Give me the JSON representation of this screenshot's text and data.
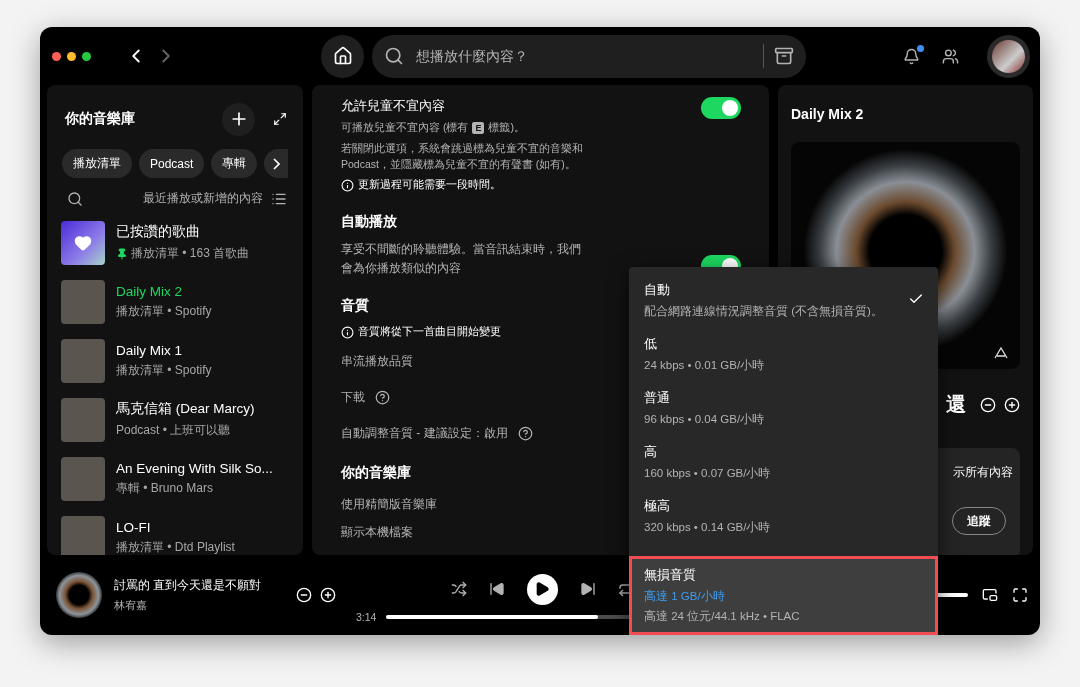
{
  "topbar": {
    "search": {
      "placeholder": "想播放什麼內容？"
    },
    "notification_dot": true
  },
  "library": {
    "title": "你的音樂庫",
    "filters": [
      {
        "label": "播放清單",
        "selected": false
      },
      {
        "label": "Podcast",
        "selected": false
      },
      {
        "label": "專輯",
        "selected": false
      }
    ],
    "sort_label": "最近播放或新增的內容",
    "items": [
      {
        "kind": "liked",
        "title": "已按讚的歌曲",
        "subtitle": "播放清單 • 163 首歌曲",
        "pinned": true,
        "playing": false
      },
      {
        "kind": "photo",
        "title": "Daily Mix 2",
        "subtitle": "播放清單 • Spotify",
        "pinned": false,
        "playing": true
      },
      {
        "kind": "photo",
        "title": "Daily Mix 1",
        "subtitle": "播放清單 • Spotify",
        "pinned": false,
        "playing": false
      },
      {
        "kind": "photo",
        "title": "馬克信箱 (Dear Marcy)",
        "subtitle": "Podcast • 上班可以聽",
        "pinned": false,
        "playing": false
      },
      {
        "kind": "photo",
        "title": "An Evening With Silk So...",
        "subtitle": "專輯 • Bruno Mars",
        "pinned": false,
        "playing": false
      },
      {
        "kind": "photo",
        "title": "LO-FI",
        "subtitle": "播放清單 • Dtd Playlist",
        "pinned": false,
        "playing": false
      }
    ]
  },
  "settings": {
    "explicit": {
      "title": "允許兒童不宜內容",
      "on": true,
      "note_before": "可播放兒童不宜內容 (標有",
      "badge": "E",
      "note_after": "標籤)。",
      "description": "若關閉此選項，系統會跳過標為兒童不宜的音樂和 Podcast，並隱藏標為兒童不宜的有聲書 (如有)。",
      "info": "更新過程可能需要一段時間。"
    },
    "autoplay": {
      "heading": "自動播放",
      "description": "享受不間斷的聆聽體驗。當音訊結束時，我們會為你播放類似的內容",
      "on": true
    },
    "quality": {
      "heading": "音質",
      "info": "音質將從下一首曲目開始變更",
      "rows": [
        {
          "label": "串流播放品質",
          "help": false
        },
        {
          "label": "下載",
          "help": true
        },
        {
          "label": "自動調整音質 - 建議設定：啟用",
          "help": true
        }
      ]
    },
    "library": {
      "heading": "你的音樂庫",
      "rows": [
        "使用精簡版音樂庫",
        "顯示本機檔案"
      ]
    }
  },
  "quality_menu": [
    {
      "title": "自動",
      "detail": "配合網路連線情況調整音質 (不含無損音質)。",
      "selected": true,
      "highlighted": false
    },
    {
      "title": "低",
      "detail": "24 kbps • 0.01 GB/小時",
      "selected": false,
      "highlighted": false
    },
    {
      "title": "普通",
      "detail": "96 kbps • 0.04 GB/小時",
      "selected": false,
      "highlighted": false
    },
    {
      "title": "高",
      "detail": "160 kbps • 0.07 GB/小時",
      "selected": false,
      "highlighted": false
    },
    {
      "title": "極高",
      "detail": "320 kbps • 0.14 GB/小時",
      "selected": false,
      "highlighted": false
    },
    {
      "title": "無損音質",
      "accent": "高達 1 GB/小時",
      "detail": "高達 24 位元/44.1 kHz • FLAC",
      "selected": false,
      "highlighted": true
    }
  ],
  "now_playing_panel": {
    "title": "Daily Mix 2",
    "track_title_fragment": "還",
    "card_text_fragment": "示所有內容",
    "follow_button": "追蹤"
  },
  "player": {
    "title": "討罵的 直到今天還是不願對",
    "artist": "林宥嘉",
    "elapsed": "3:14",
    "progress": {
      "level": 0.62
    }
  }
}
